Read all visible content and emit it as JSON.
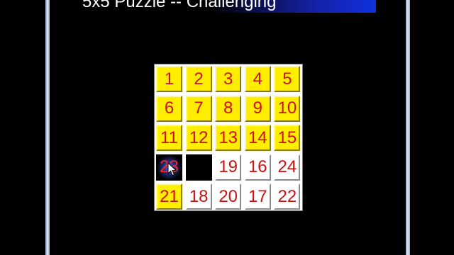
{
  "title": "5x5 Puzzle -- Challenging",
  "board": {
    "rows": 5,
    "cols": 5,
    "tiles": [
      {
        "label": "1",
        "style": "yellow"
      },
      {
        "label": "2",
        "style": "yellow"
      },
      {
        "label": "3",
        "style": "yellow"
      },
      {
        "label": "4",
        "style": "yellow"
      },
      {
        "label": "5",
        "style": "yellow"
      },
      {
        "label": "6",
        "style": "yellow"
      },
      {
        "label": "7",
        "style": "yellow"
      },
      {
        "label": "8",
        "style": "yellow"
      },
      {
        "label": "9",
        "style": "yellow"
      },
      {
        "label": "10",
        "style": "yellow"
      },
      {
        "label": "11",
        "style": "yellow"
      },
      {
        "label": "12",
        "style": "yellow"
      },
      {
        "label": "13",
        "style": "yellow"
      },
      {
        "label": "14",
        "style": "yellow"
      },
      {
        "label": "15",
        "style": "yellow"
      },
      {
        "label": "23",
        "style": "glow"
      },
      {
        "label": "",
        "style": "blank"
      },
      {
        "label": "19",
        "style": "white"
      },
      {
        "label": "16",
        "style": "white"
      },
      {
        "label": "24",
        "style": "white"
      },
      {
        "label": "21",
        "style": "yellow"
      },
      {
        "label": "18",
        "style": "white"
      },
      {
        "label": "20",
        "style": "white"
      },
      {
        "label": "17",
        "style": "white"
      },
      {
        "label": "22",
        "style": "white"
      }
    ]
  },
  "colors": {
    "tile_yellow": "#ffee00",
    "tile_white": "#ffffff",
    "number_red": "#cc1111",
    "title_bar_blue": "#1030e0"
  },
  "icons": {
    "cursor": "mouse-pointer-icon"
  }
}
